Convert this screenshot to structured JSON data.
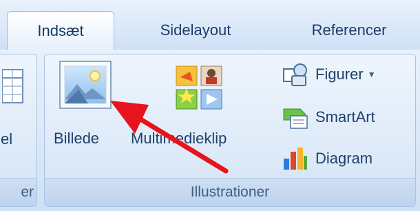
{
  "tabs": [
    "Indsæt",
    "Sidelayout",
    "Referencer"
  ],
  "left_group": {
    "item_label": "el",
    "group_label": "er"
  },
  "illustrations": {
    "group_label": "Illustrationer",
    "billede": "Billede",
    "multimedieklip": "Multimedieklip",
    "figurer": "Figurer",
    "smartart": "SmartArt",
    "diagram": "Diagram"
  },
  "colors": {
    "arrow": "#e8141b",
    "text": "#1f3f6a"
  }
}
